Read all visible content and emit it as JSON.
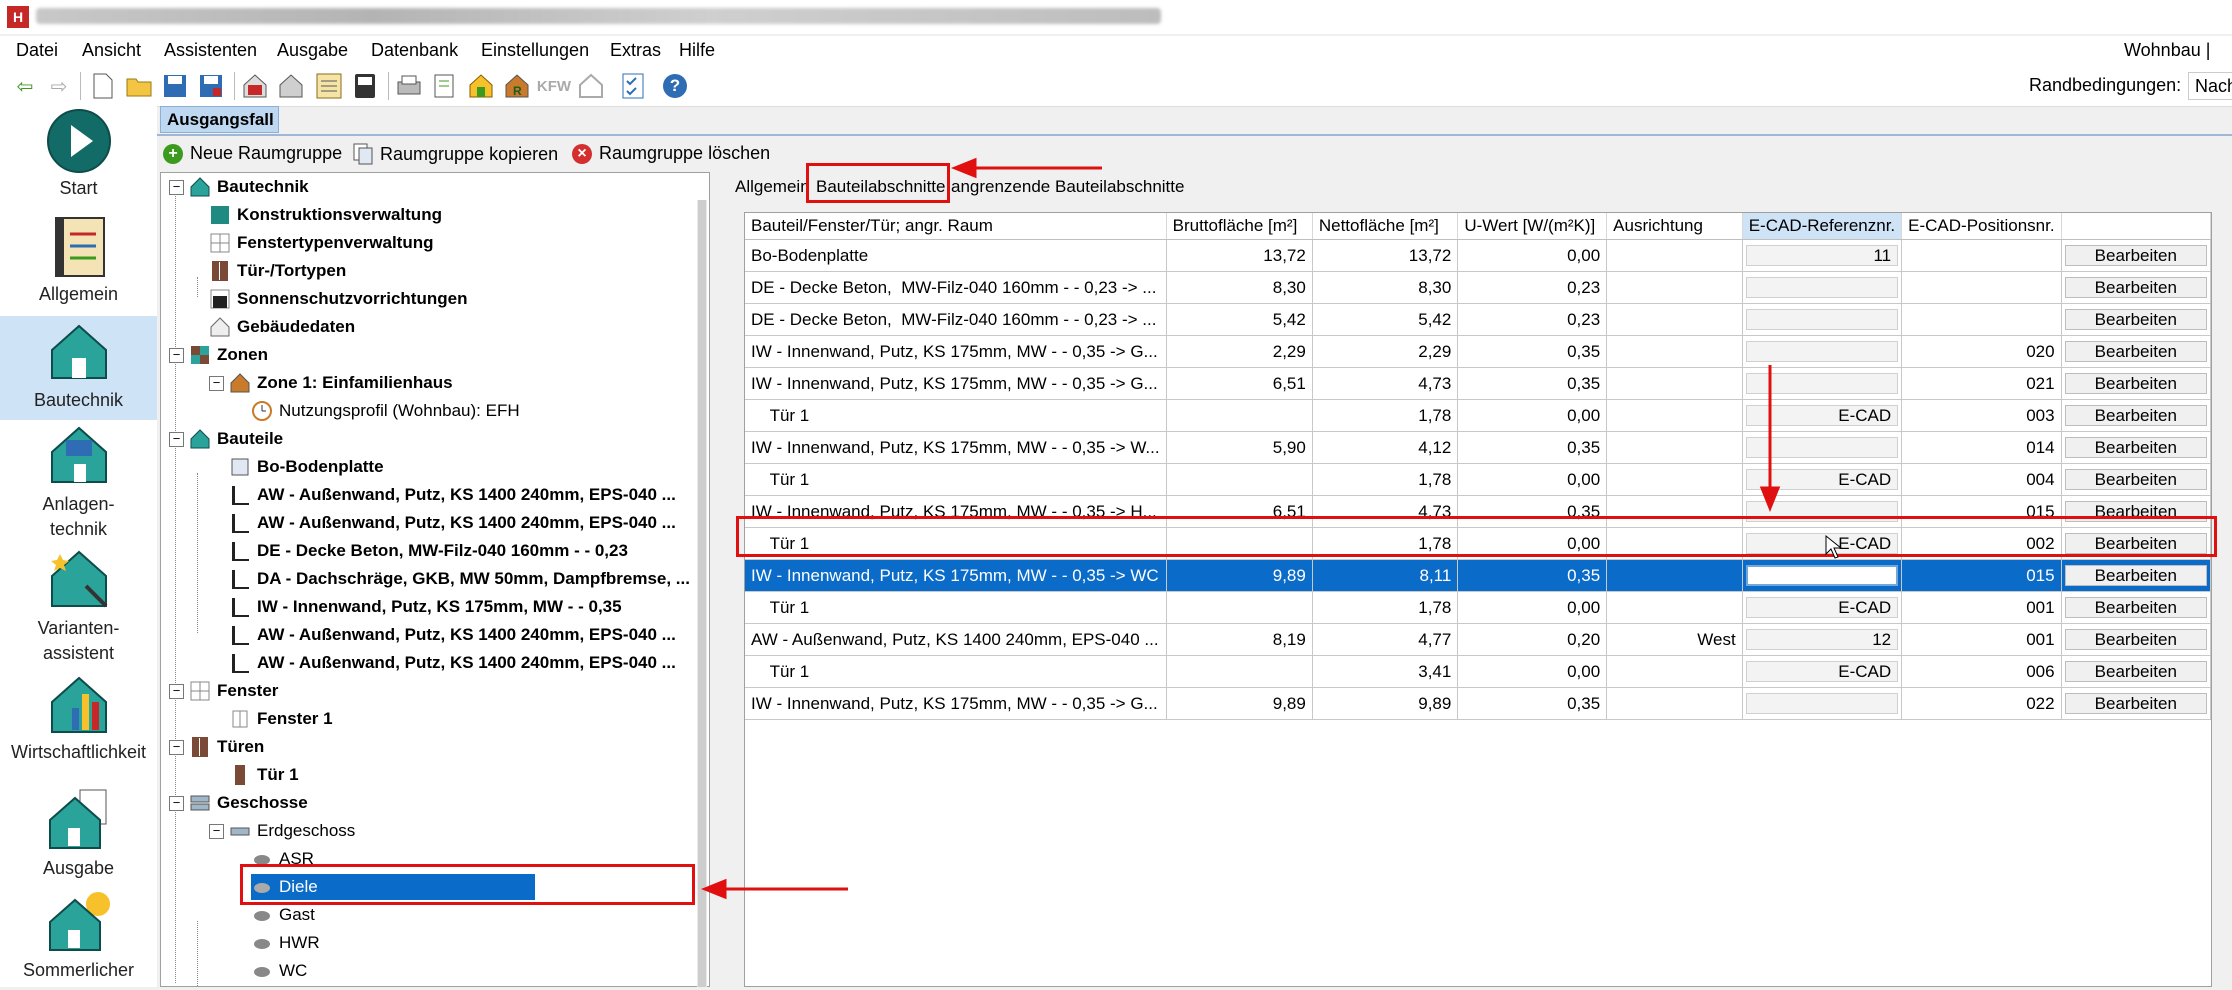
{
  "window": {
    "title_obscured": ""
  },
  "menu": [
    "Datei",
    "Ansicht",
    "Assistenten",
    "Ausgabe",
    "Datenbank",
    "Einstellungen",
    "Extras",
    "Hilfe"
  ],
  "menu_right": "Wohnbau | ",
  "toolbar": {
    "rand_label": "Randbedingungen:",
    "rand_value": "Nach",
    "kfw_text": "KFW"
  },
  "nav": [
    {
      "label": "Start"
    },
    {
      "label": "Allgemein"
    },
    {
      "label": "Bautechnik"
    },
    {
      "label": "Anlagen-\ntechnik"
    },
    {
      "label": "Varianten-\nassistent"
    },
    {
      "label": "Wirtschaftlichkeit"
    },
    {
      "label": "Ausgabe"
    },
    {
      "label": "Sommerlicher"
    }
  ],
  "case_tab": "Ausgangsfall",
  "group_actions": {
    "new": "Neue Raumgruppe",
    "copy": "Raumgruppe kopieren",
    "delete": "Raumgruppe löschen"
  },
  "tree": {
    "root": "Bautechnik",
    "konstruktion": "Konstruktionsverwaltung",
    "fenstertypen": "Fenstertypenverwaltung",
    "tueren_typen": "Tür-/Tortypen",
    "sonnenschutz": "Sonnenschutzvorrichtungen",
    "gebaeude": "Gebäudedaten",
    "zonen": "Zonen",
    "zone1": "Zone 1: Einfamilienhaus",
    "nutzungsprofil": "Nutzungsprofil (Wohnbau): EFH",
    "bauteile": "Bauteile",
    "bauteil_items": [
      "Bo-Bodenplatte",
      "AW - Außenwand, Putz, KS 1400 240mm, EPS-040 ...",
      "AW - Außenwand, Putz, KS 1400 240mm, EPS-040 ...",
      "DE - Decke Beton,  MW-Filz-040 160mm - - 0,23",
      "DA - Dachschräge, GKB, MW 50mm, Dampfbremse, ...",
      "IW - Innenwand, Putz, KS 175mm, MW - - 0,35",
      "AW - Außenwand, Putz, KS 1400 240mm, EPS-040 ...",
      "AW - Außenwand, Putz, KS 1400 240mm, EPS-040 ..."
    ],
    "fenster": "Fenster",
    "fenster1": "Fenster 1",
    "tueren": "Türen",
    "tuer1": "Tür 1",
    "geschosse": "Geschosse",
    "erdgeschoss": "Erdgeschoss",
    "rooms": [
      "ASR",
      "Diele",
      "Gast",
      "HWR",
      "WC"
    ]
  },
  "tabs": [
    "Allgemein",
    "Bauteilabschnitte",
    "angrenzende Bauteilabschnitte"
  ],
  "table": {
    "headers": [
      "Bauteil/Fenster/Tür; angr. Raum",
      "Bruttofläche [m²]",
      "Nettofläche [m²]",
      "U-Wert [W/(m²K)]",
      "Ausrichtung",
      "E-CAD-Referenznr.",
      "E-CAD-Positionsnr.",
      ""
    ],
    "rows": [
      [
        "Bo-Bodenplatte",
        "13,72",
        "13,72",
        "0,00",
        "",
        "11",
        "",
        "Bearbeiten"
      ],
      [
        "DE - Decke Beton,  MW-Filz-040 160mm - - 0,23 -> ...",
        "8,30",
        "8,30",
        "0,23",
        "",
        "",
        "",
        "Bearbeiten"
      ],
      [
        "DE - Decke Beton,  MW-Filz-040 160mm - - 0,23 -> ...",
        "5,42",
        "5,42",
        "0,23",
        "",
        "",
        "",
        "Bearbeiten"
      ],
      [
        "IW - Innenwand, Putz, KS 175mm, MW - - 0,35 -> G...",
        "2,29",
        "2,29",
        "0,35",
        "",
        "",
        "020",
        "Bearbeiten"
      ],
      [
        "IW - Innenwand, Putz, KS 175mm, MW - - 0,35 -> G...",
        "6,51",
        "4,73",
        "0,35",
        "",
        "",
        "021",
        "Bearbeiten"
      ],
      [
        "    Tür 1",
        "",
        "1,78",
        "0,00",
        "",
        "E-CAD",
        "003",
        "Bearbeiten"
      ],
      [
        "IW - Innenwand, Putz, KS 175mm, MW - - 0,35 -> W...",
        "5,90",
        "4,12",
        "0,35",
        "",
        "",
        "014",
        "Bearbeiten"
      ],
      [
        "    Tür 1",
        "",
        "1,78",
        "0,00",
        "",
        "E-CAD",
        "004",
        "Bearbeiten"
      ],
      [
        "IW - Innenwand, Putz, KS 175mm, MW - - 0,35 -> H...",
        "6,51",
        "4,73",
        "0,35",
        "",
        "",
        "015",
        "Bearbeiten"
      ],
      [
        "    Tür 1",
        "",
        "1,78",
        "0,00",
        "",
        "E-CAD",
        "002",
        "Bearbeiten"
      ],
      [
        "IW - Innenwand, Putz, KS 175mm, MW - - 0,35 -> WC",
        "9,89",
        "8,11",
        "0,35",
        "",
        "",
        "015",
        "Bearbeiten"
      ],
      [
        "    Tür 1",
        "",
        "1,78",
        "0,00",
        "",
        "E-CAD",
        "001",
        "Bearbeiten"
      ],
      [
        "AW - Außenwand, Putz, KS 1400 240mm, EPS-040 ...",
        "8,19",
        "4,77",
        "0,20",
        "West",
        "12",
        "001",
        "Bearbeiten"
      ],
      [
        "    Tür 1",
        "",
        "3,41",
        "0,00",
        "",
        "E-CAD",
        "006",
        "Bearbeiten"
      ],
      [
        "IW - Innenwand, Putz, KS 175mm, MW - - 0,35 -> G...",
        "9,89",
        "9,89",
        "0,35",
        "",
        "",
        "022",
        "Bearbeiten"
      ]
    ],
    "selected_row_index": 10
  },
  "colors": {
    "selection": "#0a6bc9",
    "annotation": "#e01010",
    "header_highlight": "#cfe3f7"
  }
}
